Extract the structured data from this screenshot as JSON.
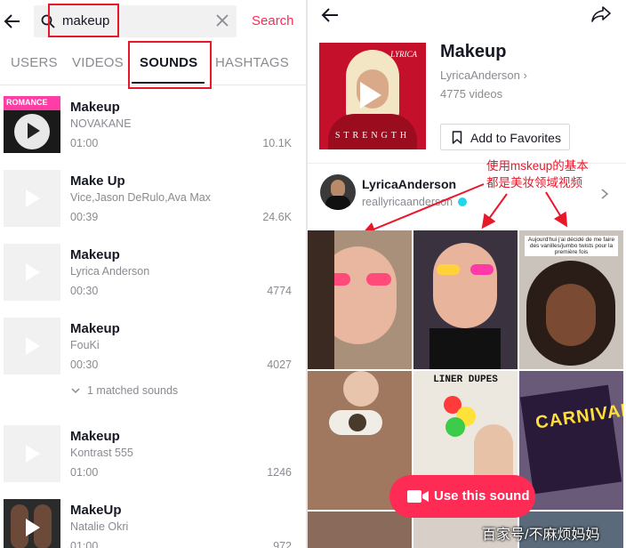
{
  "search": {
    "value": "makeup",
    "submit_label": "Search"
  },
  "tabs": [
    {
      "label": "USERS"
    },
    {
      "label": "VIDEOS"
    },
    {
      "label": "SOUNDS"
    },
    {
      "label": "HASHTAGS"
    }
  ],
  "active_tab": "SOUNDS",
  "sounds": [
    {
      "title": "Makeup",
      "artist": "NOVAKANE",
      "duration": "01:00",
      "count": "10.1K",
      "thumb_text": "ROMANCE"
    },
    {
      "title": "Make Up",
      "artist": "Vice,Jason DeRulo,Ava Max",
      "duration": "00:39",
      "count": "24.6K"
    },
    {
      "title": "Makeup",
      "artist": "Lyrica Anderson",
      "duration": "00:30",
      "count": "4774"
    },
    {
      "title": "Makeup",
      "artist": "FouKi",
      "duration": "00:30",
      "count": "4027"
    },
    {
      "title": "Makeup",
      "artist": "Kontrast 555",
      "duration": "01:00",
      "count": "1246"
    },
    {
      "title": "MakeUp",
      "artist": "Natalie Okri",
      "duration": "01:00",
      "count": "972"
    }
  ],
  "matched_sounds": "1 matched sounds",
  "detail": {
    "title": "Makeup",
    "artist": "LyricaAnderson",
    "videos": "4775 videos",
    "favorites_label": "Add to Favorites",
    "cover_title": "STRENGTH",
    "cover_brand": "LYRICA",
    "creator_name": "LyricaAnderson",
    "creator_handle": "reallyricaanderson",
    "annotation_line1": "使用mskeup的基本",
    "annotation_line2": "都是美妆领域视频",
    "grid_caption_3": "Aujourd'hui j'ai décidé de me faire des vanilles/jumbo twists pour la première fois",
    "grid_caption_5": "LINER DUPES",
    "grid_caption_6": "CARNIVAL",
    "use_sound_label": "Use this sound",
    "watermark": "百家号/不麻烦妈妈"
  },
  "colors": {
    "accent": "#fe2c55",
    "annotation": "#e8182b",
    "muted": "#8a8b91"
  }
}
